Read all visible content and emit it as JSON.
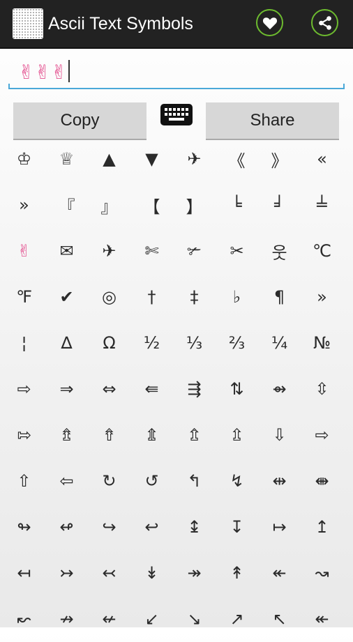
{
  "app": {
    "title": "Ascii Text Symbols",
    "icon": "app-dot-grid-icon",
    "accent_color": "#6dbb2f"
  },
  "actions": {
    "favorite_icon": "heart-icon",
    "share_icon": "share-nodes-icon"
  },
  "input": {
    "value": "✌✌✌"
  },
  "buttons": {
    "copy_label": "Copy",
    "keyboard_icon": "keyboard-icon",
    "share_label": "Share"
  },
  "symbols": [
    "♔",
    "♕",
    "▲",
    "▼",
    "✈",
    "《",
    "》",
    "«",
    "»",
    "『",
    "』",
    "【",
    "】",
    "╘",
    "╛",
    "╧",
    "✌",
    "✉",
    "✈",
    "✄",
    "✃",
    "✂",
    "웃",
    "℃",
    "℉",
    "✔",
    "◎",
    "†",
    "‡",
    "♭",
    "¶",
    "»",
    "¦",
    "∆",
    "Ω",
    "½",
    "⅓",
    "⅔",
    "¼",
    "№",
    "⇨",
    "⇒",
    "⇔",
    "⇚",
    "⇶",
    "⇅",
    "⇴",
    "⇳",
    "⇰",
    "⇯",
    "⇮",
    "⇭",
    "⇬",
    "⇫",
    "⇩",
    "⇨",
    "⇧",
    "⇦",
    "↻",
    "↺",
    "↰",
    "↯",
    "⇹",
    "⇼",
    "↬",
    "↫",
    "↪",
    "↩",
    "↨",
    "↧",
    "↦",
    "↥",
    "↤",
    "↣",
    "↢",
    "↡",
    "↠",
    "↟",
    "↞",
    "↝",
    "↜",
    "↛",
    "↚",
    "↙",
    "↘",
    "↗",
    "↖",
    "↞"
  ]
}
